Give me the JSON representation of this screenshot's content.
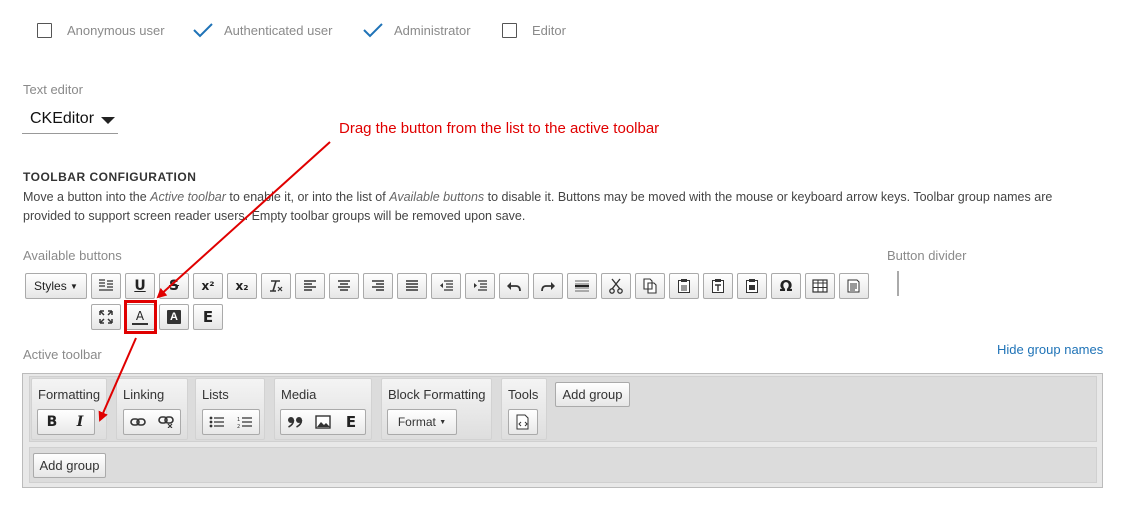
{
  "roles": [
    {
      "label": "Anonymous user",
      "checked": false
    },
    {
      "label": "Authenticated user",
      "checked": true
    },
    {
      "label": "Administrator",
      "checked": true
    },
    {
      "label": "Editor",
      "checked": false
    }
  ],
  "text_editor": {
    "label": "Text editor",
    "value": "CKEditor"
  },
  "annotation": {
    "text": "Drag the button from the list to the active toolbar",
    "color": "#e00000"
  },
  "toolbar_config": {
    "heading": "TOOLBAR CONFIGURATION",
    "desc_1": "Move a button into the ",
    "desc_active": "Active toolbar",
    "desc_2": " to enable it, or into the list of ",
    "desc_available": "Available buttons",
    "desc_3": " to disable it. Buttons may be moved with the mouse or keyboard arrow keys. Toolbar group names are",
    "desc_4": "provided to support screen reader users. Empty toolbar groups will be removed upon save."
  },
  "available": {
    "label": "Available buttons",
    "styles_label": "Styles",
    "divider_label": "Button divider",
    "buttons": [
      "styles",
      "show-blocks-icon",
      "underline-icon",
      "strikethrough-icon",
      "superscript-icon",
      "subscript-icon",
      "remove-format-icon",
      "align-left-icon",
      "align-center-icon",
      "align-right-icon",
      "justify-icon",
      "outdent-icon",
      "indent-icon",
      "undo-icon",
      "redo-icon",
      "horizontal-rule-icon",
      "cut-icon",
      "copy-icon",
      "paste-icon",
      "paste-text-icon",
      "paste-word-icon",
      "special-char-icon",
      "table-icon",
      "source-icon",
      "maximize-icon",
      "text-color-icon",
      "bg-color-icon",
      "embed-icon"
    ],
    "glyphs": {
      "underline": "U",
      "strike": "S",
      "sup": "x²",
      "sub": "x₂",
      "omega": "Ω",
      "textcolor": "A",
      "bgcolor": "A",
      "embed": "E"
    }
  },
  "active": {
    "label": "Active toolbar",
    "hide_link": "Hide group names",
    "groups": [
      {
        "name": "Formatting",
        "buttons": [
          "B",
          "I"
        ]
      },
      {
        "name": "Linking",
        "buttons": [
          "link-icon",
          "unlink-icon"
        ]
      },
      {
        "name": "Lists",
        "buttons": [
          "bullet-list-icon",
          "numbered-list-icon"
        ]
      },
      {
        "name": "Media",
        "buttons": [
          "blockquote-icon",
          "image-icon",
          "E"
        ]
      },
      {
        "name": "Block Formatting",
        "buttons": [
          "Format"
        ]
      },
      {
        "name": "Tools",
        "buttons": [
          "source-icon"
        ]
      }
    ],
    "add_group": "Add group",
    "add_group_row2": "Add group"
  }
}
